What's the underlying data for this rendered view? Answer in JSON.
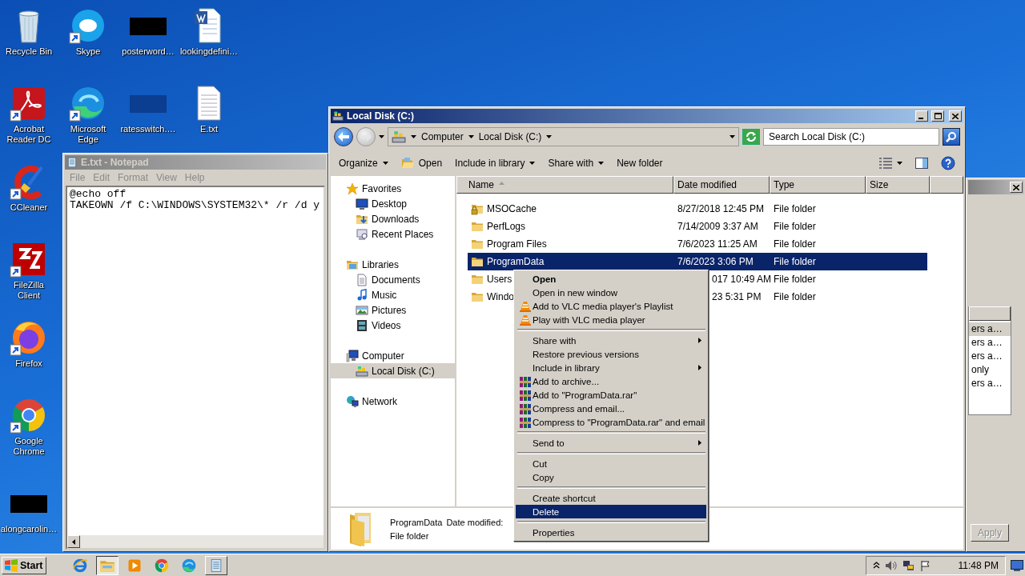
{
  "desktop_icons": [
    {
      "label": "Recycle Bin",
      "kind": "recycle",
      "shortcut": false
    },
    {
      "label": "Skype",
      "kind": "skype",
      "shortcut": true
    },
    {
      "label": "posterword…",
      "kind": "black-thumb",
      "shortcut": false
    },
    {
      "label": "lookingdefini…",
      "kind": "word",
      "shortcut": false
    },
    {
      "label": "Acrobat Reader DC",
      "kind": "acrobat",
      "shortcut": true
    },
    {
      "label": "Microsoft Edge",
      "kind": "edge",
      "shortcut": true
    },
    {
      "label": "ratesswitch.…",
      "kind": "blue-thumb",
      "shortcut": false
    },
    {
      "label": "E.txt",
      "kind": "text",
      "shortcut": false
    },
    {
      "label": "CCleaner",
      "kind": "ccleaner",
      "shortcut": true
    },
    {
      "label": "FileZilla Client",
      "kind": "filezilla",
      "shortcut": true
    },
    {
      "label": "Firefox",
      "kind": "firefox",
      "shortcut": true
    },
    {
      "label": "Google Chrome",
      "kind": "chrome",
      "shortcut": true
    },
    {
      "label": "alongcarolin…",
      "kind": "black-thumb",
      "shortcut": false
    }
  ],
  "notepad": {
    "title": "E.txt - Notepad",
    "menu": [
      "File",
      "Edit",
      "Format",
      "View",
      "Help"
    ],
    "lines": [
      "@echo off",
      "TAKEOWN /f C:\\WINDOWS\\SYSTEM32\\* /r /d y"
    ]
  },
  "background_window": {
    "list_items": [
      {
        "label": "ers a…",
        "selected": true
      },
      {
        "label": "ers a…",
        "selected": false
      },
      {
        "label": "ers a…",
        "selected": false
      },
      {
        "label": "only",
        "selected": false
      },
      {
        "label": "ers a…",
        "selected": false
      }
    ],
    "button": {
      "label": "Apply",
      "disabled": true
    }
  },
  "explorer": {
    "title": "Local Disk (C:)",
    "breadcrumbs": [
      "Computer",
      "Local Disk (C:)"
    ],
    "search": {
      "placeholder": "Search Local Disk (C:)"
    },
    "toolbar": [
      {
        "label": "Organize",
        "kind": "dropdown"
      },
      {
        "label": "Open",
        "kind": "open"
      },
      {
        "label": "Include in library",
        "kind": "dropdown"
      },
      {
        "label": "Share with",
        "kind": "dropdown"
      },
      {
        "label": "New folder",
        "kind": "plain"
      }
    ],
    "nav": [
      {
        "label": "Favorites",
        "kind": "star",
        "selected": false,
        "children": [
          {
            "label": "Desktop",
            "kind": "desktop",
            "selected": false
          },
          {
            "label": "Downloads",
            "kind": "downloads",
            "selected": false
          },
          {
            "label": "Recent Places",
            "kind": "recent",
            "selected": false
          }
        ]
      },
      {
        "label": "Libraries",
        "kind": "libraries",
        "selected": false,
        "children": [
          {
            "label": "Documents",
            "kind": "documents",
            "selected": false
          },
          {
            "label": "Music",
            "kind": "music",
            "selected": false
          },
          {
            "label": "Pictures",
            "kind": "pictures",
            "selected": false
          },
          {
            "label": "Videos",
            "kind": "videos",
            "selected": false
          }
        ]
      },
      {
        "label": "Computer",
        "kind": "computer",
        "selected": false,
        "children": [
          {
            "label": "Local Disk (C:)",
            "kind": "disk",
            "selected": true
          }
        ]
      },
      {
        "label": "Network",
        "kind": "network",
        "selected": false
      }
    ],
    "columns": [
      {
        "label": "Name",
        "sorted": true
      },
      {
        "label": "Date modified",
        "sorted": false
      },
      {
        "label": "Type",
        "sorted": false
      },
      {
        "label": "Size",
        "sorted": false
      }
    ],
    "rows": [
      {
        "name": "MSOCache",
        "date": "8/27/2018 12:45 PM",
        "type": "File folder",
        "kind": "locked-folder",
        "selected": false
      },
      {
        "name": "PerfLogs",
        "date": "7/14/2009 3:37 AM",
        "type": "File folder",
        "kind": "folder",
        "selected": false
      },
      {
        "name": "Program Files",
        "date": "7/6/2023 11:25 AM",
        "type": "File folder",
        "kind": "folder",
        "selected": false
      },
      {
        "name": "ProgramData",
        "date": "7/6/2023 3:06 PM",
        "type": "File folder",
        "kind": "folder",
        "selected": true
      },
      {
        "name": "Users",
        "date": "017 10:49 AM",
        "type": "File folder",
        "kind": "folder",
        "selected": false
      },
      {
        "name": "Windo",
        "date": "23 5:31 PM",
        "type": "File folder",
        "kind": "folder",
        "selected": false
      }
    ],
    "details": {
      "name": "ProgramData",
      "date_label": "Date modified:",
      "type": "File folder"
    }
  },
  "context_menu": {
    "items": [
      {
        "kind": "item",
        "label": "Open",
        "bold": true,
        "submenu": false,
        "selected": false
      },
      {
        "kind": "item",
        "label": "Open in new window",
        "submenu": false,
        "selected": false
      },
      {
        "kind": "vlc-item",
        "label": "Add to VLC media player's Playlist",
        "submenu": false,
        "selected": false
      },
      {
        "kind": "vlc-item",
        "label": "Play with VLC media player",
        "submenu": false,
        "selected": false
      },
      {
        "kind": "separator"
      },
      {
        "kind": "item",
        "label": "Share with",
        "submenu": true,
        "selected": false
      },
      {
        "kind": "item",
        "label": "Restore previous versions",
        "submenu": false,
        "selected": false
      },
      {
        "kind": "item",
        "label": "Include in library",
        "submenu": true,
        "selected": false
      },
      {
        "kind": "rar-item",
        "label": "Add to archive...",
        "submenu": false,
        "selected": false
      },
      {
        "kind": "rar-item",
        "label": "Add to \"ProgramData.rar\"",
        "submenu": false,
        "selected": false
      },
      {
        "kind": "rar-item",
        "label": "Compress and email...",
        "submenu": false,
        "selected": false
      },
      {
        "kind": "rar-item",
        "label": "Compress to \"ProgramData.rar\" and email",
        "submenu": false,
        "selected": false
      },
      {
        "kind": "separator"
      },
      {
        "kind": "item",
        "label": "Send to",
        "submenu": true,
        "selected": false
      },
      {
        "kind": "separator"
      },
      {
        "kind": "item",
        "label": "Cut",
        "submenu": false,
        "selected": false
      },
      {
        "kind": "item",
        "label": "Copy",
        "submenu": false,
        "selected": false
      },
      {
        "kind": "separator"
      },
      {
        "kind": "item",
        "label": "Create shortcut",
        "submenu": false,
        "selected": false
      },
      {
        "kind": "item",
        "label": "Delete",
        "submenu": false,
        "selected": true
      },
      {
        "kind": "separator"
      },
      {
        "kind": "item",
        "label": "Properties",
        "submenu": false,
        "selected": false
      }
    ]
  },
  "taskbar": {
    "start": "Start",
    "apps": [
      {
        "kind": "ie",
        "open": false,
        "active": false
      },
      {
        "kind": "explorer",
        "open": true,
        "active": true
      },
      {
        "kind": "media",
        "open": false,
        "active": false
      },
      {
        "kind": "chrome",
        "open": false,
        "active": false
      },
      {
        "kind": "edge",
        "open": false,
        "active": false
      },
      {
        "kind": "notepad",
        "open": true,
        "active": false
      }
    ],
    "clock": "11:48 PM"
  }
}
